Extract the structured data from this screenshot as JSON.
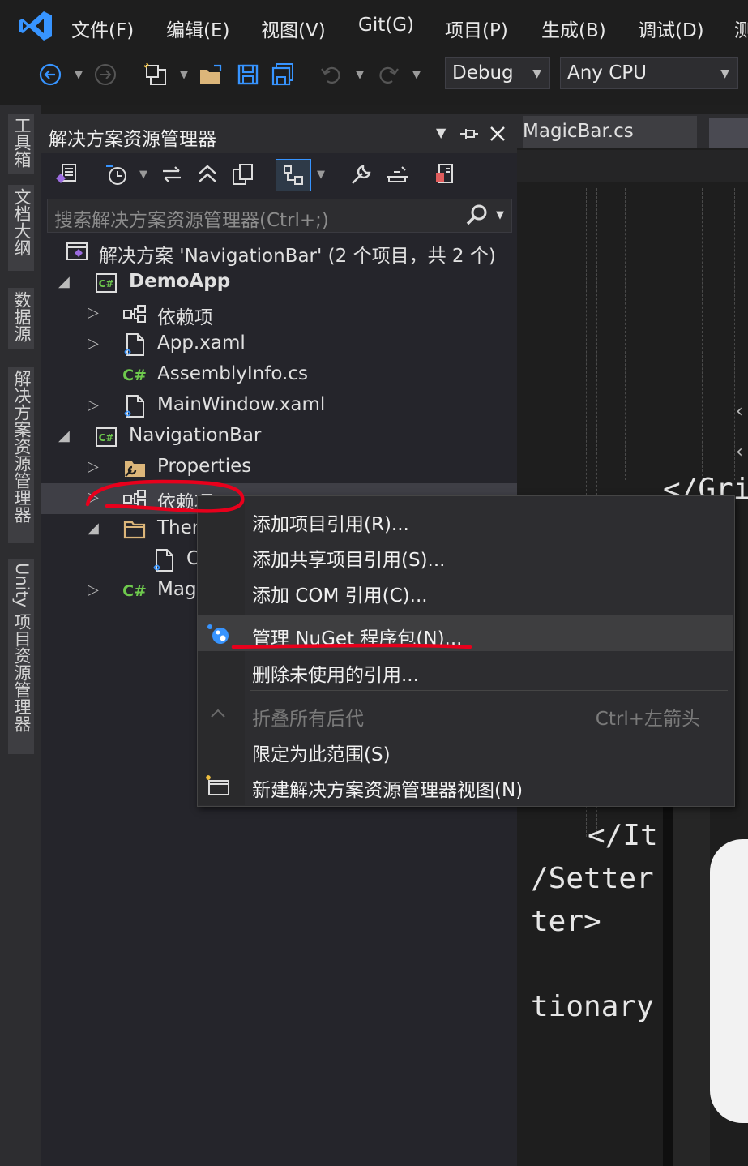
{
  "menubar": {
    "items": [
      {
        "label": "文件(F)"
      },
      {
        "label": "编辑(E)"
      },
      {
        "label": "视图(V)"
      },
      {
        "label": "Git(G)"
      },
      {
        "label": "项目(P)"
      },
      {
        "label": "生成(B)"
      },
      {
        "label": "调试(D)"
      },
      {
        "label": "测"
      }
    ]
  },
  "toolbar": {
    "config": "Debug",
    "platform": "Any CPU"
  },
  "rail": {
    "tabs": [
      "工具箱",
      "文档大纲",
      "数据源",
      "解决方案资源管理器",
      "Unity 项目资源管理器"
    ]
  },
  "solution_explorer": {
    "title": "解决方案资源管理器",
    "search_placeholder": "搜索解决方案资源管理器(Ctrl+;)",
    "tree": [
      {
        "label": "解决方案 'NavigationBar' (2 个项目，共 2 个)",
        "icon": "solution-icon"
      },
      {
        "label": "DemoApp",
        "icon": "csharp-project-icon",
        "bold": true
      },
      {
        "label": "依赖项",
        "icon": "dependencies-icon"
      },
      {
        "label": "App.xaml",
        "icon": "xaml-file-icon"
      },
      {
        "label": "AssemblyInfo.cs",
        "icon": "csharp-file-icon"
      },
      {
        "label": "MainWindow.xaml",
        "icon": "xaml-file-icon"
      },
      {
        "label": "NavigationBar",
        "icon": "csharp-project-icon"
      },
      {
        "label": "Properties",
        "icon": "properties-folder-icon"
      },
      {
        "label": "依赖项",
        "icon": "dependencies-icon"
      },
      {
        "label": "Ther",
        "icon": "folder-icon"
      },
      {
        "label": "C",
        "icon": "xaml-file-icon"
      },
      {
        "label": "Mag",
        "icon": "csharp-file-icon"
      }
    ]
  },
  "editor": {
    "tab_label": "MagicBar.cs",
    "code_fragments": [
      "</Gri",
      "</It",
      "/Setter",
      "ter>",
      "tionary"
    ]
  },
  "context_menu": {
    "items": [
      {
        "label": "添加项目引用(R)..."
      },
      {
        "label": "添加共享项目引用(S)..."
      },
      {
        "label": "添加 COM 引用(C)..."
      },
      {
        "label": "管理 NuGet 程序包(N)...",
        "icon": "nuget-icon"
      },
      {
        "label": "删除未使用的引用..."
      },
      {
        "label": "折叠所有后代",
        "shortcut": "Ctrl+左箭头",
        "disabled": true,
        "icon": "collapse-icon"
      },
      {
        "label": "限定为此范围(S)"
      },
      {
        "label": "新建解决方案资源管理器视图(N)",
        "icon": "new-view-icon"
      }
    ]
  },
  "colors": {
    "accent": "#3794ff",
    "annotation_red": "#e8001c",
    "csharp_green": "#6ec94d"
  }
}
